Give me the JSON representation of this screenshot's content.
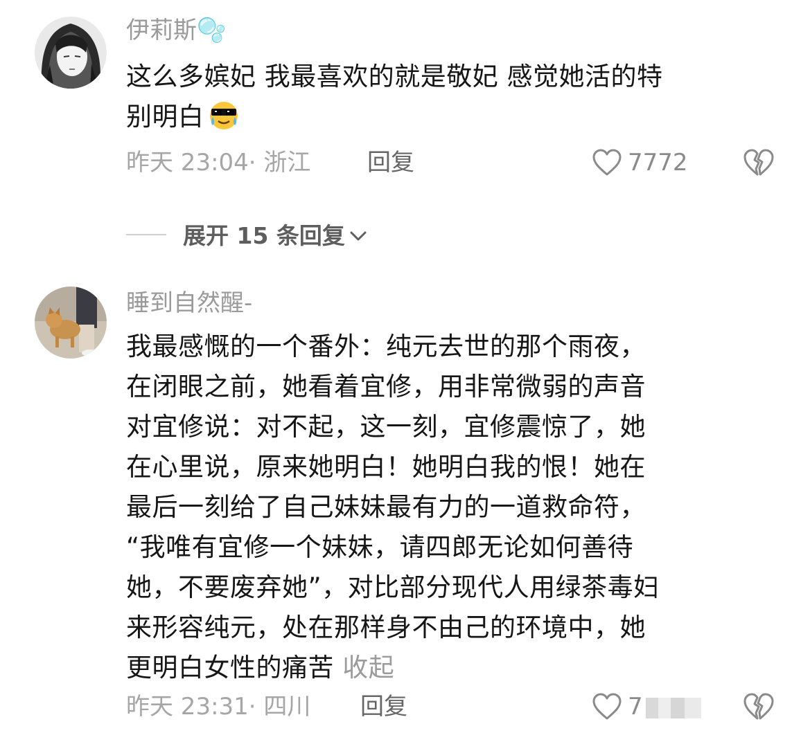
{
  "comments": [
    {
      "username": "伊莉斯🫧",
      "text_line1": "这么多嫔妃 我最喜欢的就是敬妃 感觉她活的特",
      "text_line2": "别明白",
      "emoji": "cool-tears-emoji",
      "time_location": "昨天 23:04· 浙江",
      "reply_label": "回复",
      "likes": "7772",
      "like_icon": "heart-outline-icon",
      "dislike_icon": "broken-heart-icon"
    },
    {
      "username": "睡到自然醒-",
      "text_lines": [
        "我最感慨的一个番外：纯元去世的那个雨夜，",
        "在闭眼之前，她看着宜修，用非常微弱的声音",
        "对宜修说：对不起，这一刻，宜修震惊了，她",
        "在心里说，原来她明白！她明白我的恨！她在",
        "最后一刻给了自己妹妹最有力的一道救命符，",
        "“我唯有宜修一个妹妹，请四郎无论如何善待",
        "她，不要废弃她”，对比部分现代人用绿茶毒妇",
        "来形容纯元，处在那样身不由己的环境中，她",
        "更明白女性的痛苦"
      ],
      "collapse_label": "收起",
      "time_location": "昨天 23:31· 四川",
      "reply_label": "回复",
      "likes_visible": "7",
      "like_icon": "heart-outline-icon",
      "dislike_icon": "broken-heart-icon"
    }
  ],
  "expand_replies": {
    "label": "展开 15 条回复",
    "icon": "chevron-down-icon"
  },
  "colors": {
    "username": "#9a9a9a",
    "body_text": "#161616",
    "meta": "#a6a6a6",
    "reply": "#666666",
    "expand": "#5e5e5e"
  }
}
